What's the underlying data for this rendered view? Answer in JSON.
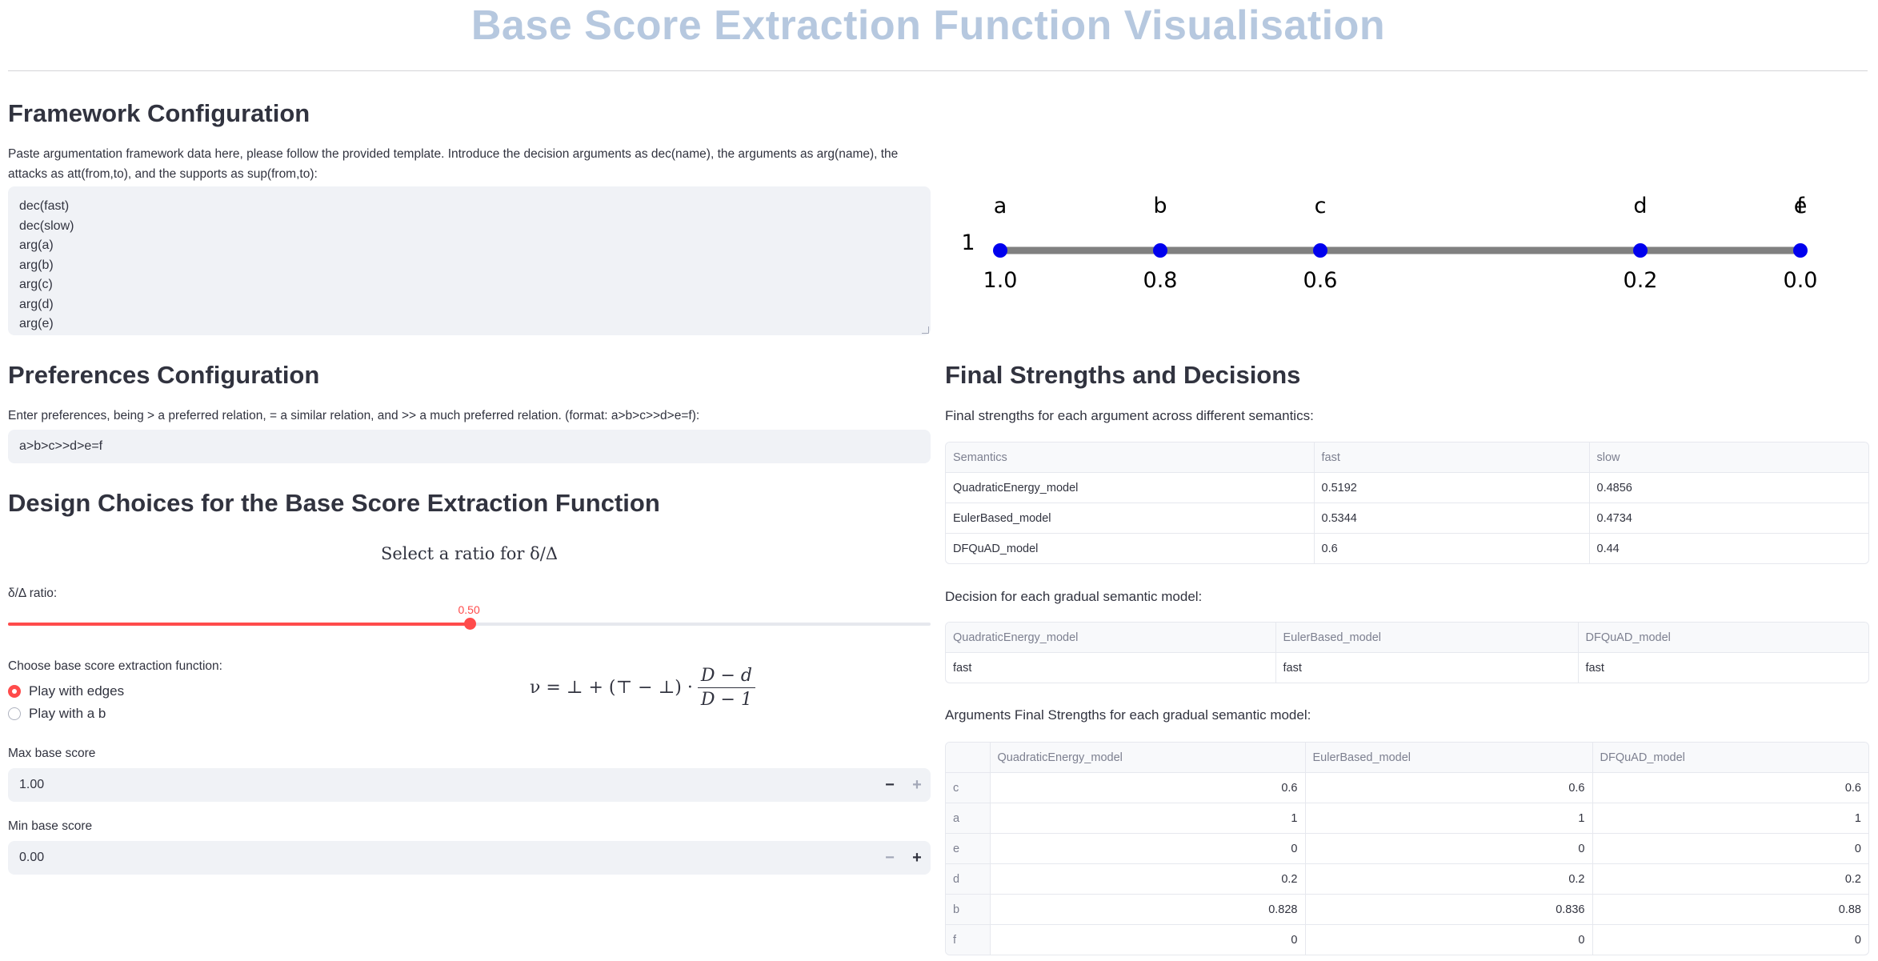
{
  "page_title": "Base Score Extraction Function Visualisation",
  "framework": {
    "heading": "Framework Configuration",
    "instructions": "Paste argumentation framework data here, please follow the provided template. Introduce the decision arguments as dec(name), the arguments as arg(name), the attacks as att(from,to), and the supports as sup(from,to):",
    "lines": [
      "dec(fast)",
      "dec(slow)",
      "arg(a)",
      "arg(b)",
      "arg(c)",
      "arg(d)",
      "arg(e)"
    ]
  },
  "number_line": {
    "left_label": "1",
    "right_label": "0",
    "points": [
      {
        "name": "a",
        "value": "1.0"
      },
      {
        "name": "b",
        "value": "0.8"
      },
      {
        "name": "c",
        "value": "0.6"
      },
      {
        "name": "d",
        "value": "0.2"
      },
      {
        "name": "e",
        "value": "0.0"
      }
    ],
    "overlap_label": "f",
    "colors": {
      "line": "#808080",
      "point": "#0000ee"
    }
  },
  "preferences": {
    "heading": "Preferences Configuration",
    "instructions": "Enter preferences, being > a preferred relation, = a similar relation, and >> a much preferred relation. (format: a>b>c>>d>e=f):",
    "value": "a>b>c>>d>e=f"
  },
  "design": {
    "heading": "Design Choices for the Base Score Extraction Function",
    "ratio_heading": "Select a ratio for δ/Δ",
    "slider_label": "δ/Δ ratio:",
    "slider_value": "0.50",
    "slider_fraction": 0.5,
    "function_label": "Choose base score extraction function:",
    "options": [
      {
        "label": "Play with edges",
        "selected": true
      },
      {
        "label": "Play with a b",
        "selected": false
      }
    ],
    "formula": {
      "lhs": "ν = ⊥ + (⊤ − ⊥) ·",
      "numerator": "D − d",
      "denominator": "D − 1"
    },
    "max_label": "Max base score",
    "max_value": "1.00",
    "min_label": "Min base score",
    "min_value": "0.00",
    "minus": "−",
    "plus": "+"
  },
  "results": {
    "heading": "Final Strengths and Decisions",
    "strengths_caption": "Final strengths for each argument across different semantics:",
    "strengths_table": {
      "columns": [
        "Semantics",
        "fast",
        "slow"
      ],
      "rows": [
        [
          "QuadraticEnergy_model",
          "0.5192",
          "0.4856"
        ],
        [
          "EulerBased_model",
          "0.5344",
          "0.4734"
        ],
        [
          "DFQuAD_model",
          "0.6",
          "0.44"
        ]
      ]
    },
    "decision_caption": "Decision for each gradual semantic model:",
    "decision_table": {
      "columns": [
        "QuadraticEnergy_model",
        "EulerBased_model",
        "DFQuAD_model"
      ],
      "rows": [
        [
          "fast",
          "fast",
          "fast"
        ]
      ]
    },
    "args_caption": "Arguments Final Strengths for each gradual semantic model:",
    "args_table": {
      "columns": [
        "",
        "QuadraticEnergy_model",
        "EulerBased_model",
        "DFQuAD_model"
      ],
      "rows": [
        [
          "c",
          "0.6",
          "0.6",
          "0.6"
        ],
        [
          "a",
          "1",
          "1",
          "1"
        ],
        [
          "e",
          "0",
          "0",
          "0"
        ],
        [
          "d",
          "0.2",
          "0.2",
          "0.2"
        ],
        [
          "b",
          "0.828",
          "0.836",
          "0.88"
        ],
        [
          "f",
          "0",
          "0",
          "0"
        ]
      ]
    }
  }
}
